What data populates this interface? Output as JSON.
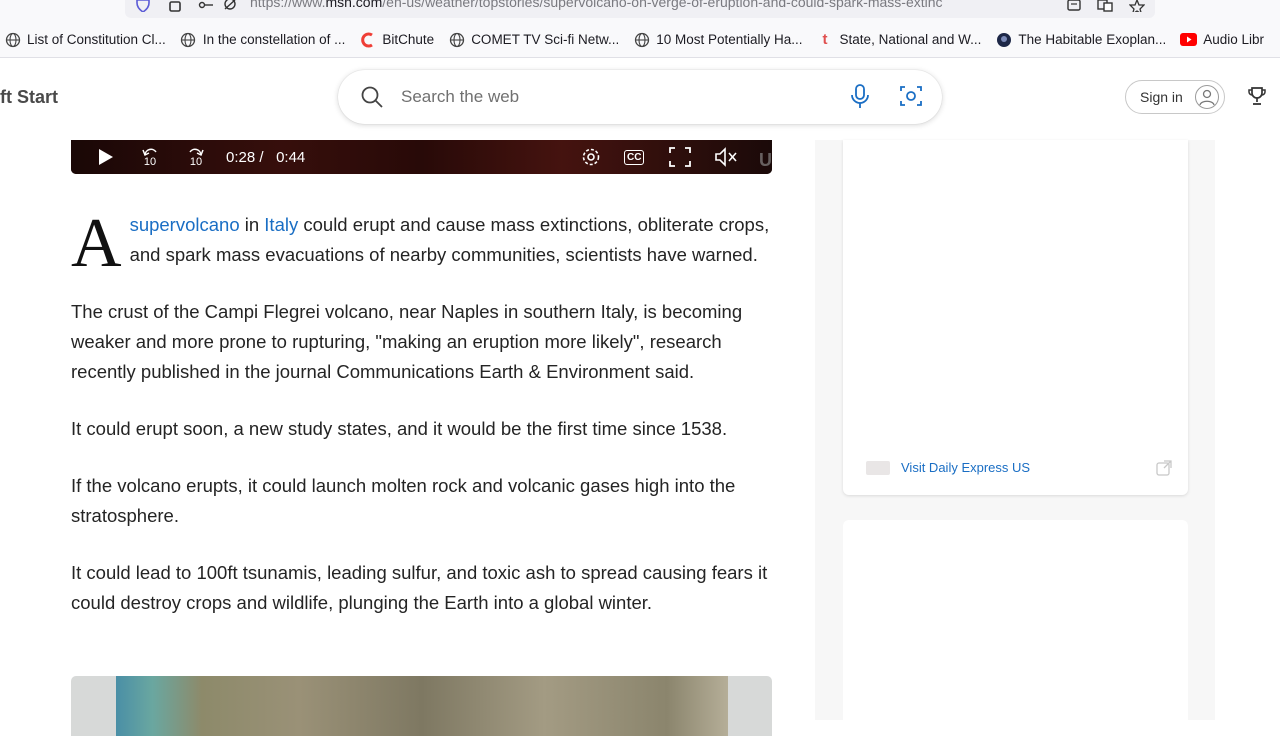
{
  "browser": {
    "url_prefix": "https://www.",
    "url_domain": "msn.com",
    "url_path": "/en-us/weather/topstories/supervolcano-on-verge-of-eruption-and-could-spark-mass-extinc",
    "icons": [
      "shield-icon",
      "lock-icon",
      "permissions-icon",
      "tracking-icon",
      "reader-icon",
      "translate-icon",
      "star-icon"
    ]
  },
  "bookmarks": [
    {
      "label": "List of Constitution Cl...",
      "icon": "globe-icon"
    },
    {
      "label": "In the constellation of ...",
      "icon": "globe-icon"
    },
    {
      "label": "BitChute",
      "icon": "bitchute-icon",
      "color": "#ef3e36"
    },
    {
      "label": "COMET TV Sci-fi Netw...",
      "icon": "globe-icon"
    },
    {
      "label": "10 Most Potentially Ha...",
      "icon": "globe-icon"
    },
    {
      "label": "State, National and W...",
      "icon": "t-icon",
      "color": "#e0504f"
    },
    {
      "label": "The Habitable Exoplan...",
      "icon": "planet-icon"
    },
    {
      "label": "Audio Libr",
      "icon": "youtube-icon",
      "color": "#ff0000"
    }
  ],
  "header": {
    "brand": "ft Start",
    "search_placeholder": "Search the web",
    "signin_label": "Sign in"
  },
  "video": {
    "current_time": "0:28",
    "separator": "/",
    "duration": "0:44",
    "skip_back": "10",
    "skip_forward": "10",
    "cc_label": "CC",
    "watermark": "USGS"
  },
  "article": {
    "dropcap": "A",
    "p1_link1": "supervolcano",
    "p1_in": " in ",
    "p1_link2": "Italy",
    "p1_rest": " could erupt and cause mass extinctions, obliterate crops, and spark mass evacuations of nearby communities, scientists have warned.",
    "paragraphs": [
      "The crust of the Campi Flegrei volcano, near Naples in southern Italy, is becoming weaker and more prone to rupturing, \"making an eruption more likely\", research recently published in the journal Communications Earth & Environment said.",
      "It could erupt soon, a new study states, and it would be the first time since 1538.",
      "If the volcano erupts, it could launch molten rock and volcanic gases high into the stratosphere.",
      "It could lead to 100ft tsunamis, leading sulfur, and toxic ash to spread causing fears it could destroy crops and wildlife, plunging the Earth into a global winter."
    ]
  },
  "sidebar": {
    "visit_label": "Visit Daily Express US",
    "accent": "#1a6ec4"
  }
}
